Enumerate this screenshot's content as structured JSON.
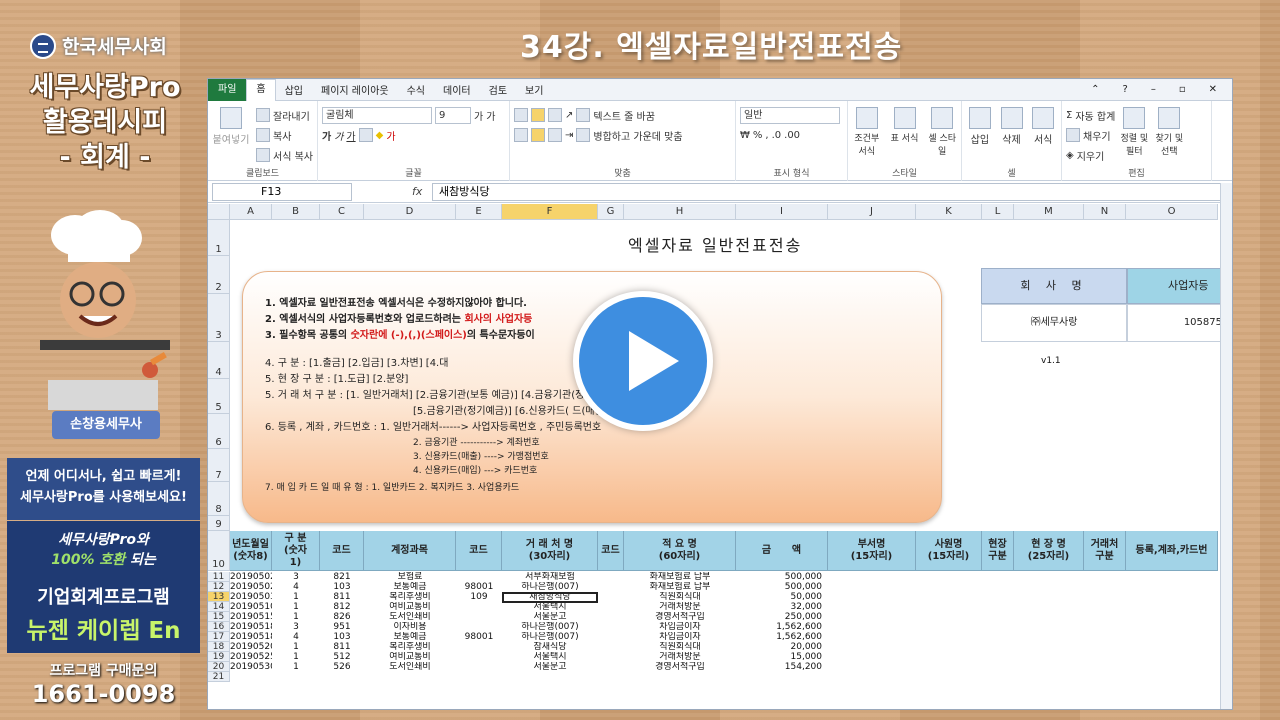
{
  "brand": {
    "name": "한국세무사회"
  },
  "left": {
    "title_lines": [
      "세무사랑Pro",
      "활용레시피",
      "- 회계 -"
    ],
    "presenter": "손창용세무사",
    "ad1": [
      "언제 어디서나, 쉽고 빠르게!",
      "세무사랑Pro를 사용해보세요!"
    ],
    "ad2_line1_a": "세무사랑Pro와",
    "ad2_line1_b": "100% 호환",
    "ad2_line1_c": " 되는",
    "ad2_line2": "기업회계프로그램",
    "ad2_line3": "뉴젠 케이렙 En",
    "contact_label": "프로그램 구매문의",
    "contact_number": "1661-0098"
  },
  "lecture_title": "34강. 엑셀자료일반전표전송",
  "excel": {
    "tabs": [
      "파일",
      "홈",
      "삽입",
      "페이지 레이아웃",
      "수식",
      "데이터",
      "검토",
      "보기"
    ],
    "clipboard": {
      "paste": "붙여넣기",
      "cut": "잘라내기",
      "copy": "복사",
      "format": "서식 복사",
      "label": "클립보드"
    },
    "font": {
      "name": "굴림체",
      "size": "9",
      "label": "글꼴"
    },
    "align": {
      "wrap": "텍스트 줄 바꿈",
      "merge": "병합하고 가운데 맞춤",
      "label": "맞춤"
    },
    "number": {
      "format": "일반",
      "label": "표시 형식"
    },
    "style": {
      "cond": "조건부 서식",
      "table": "표 서식",
      "cell": "셀 스타일",
      "label": "스타일"
    },
    "cells": {
      "insert": "삽입",
      "delete": "삭제",
      "format": "서식",
      "label": "셀"
    },
    "edit": {
      "sum": "자동 합계",
      "fill": "채우기",
      "clear": "지우기",
      "sort": "정렬 및 필터",
      "find": "찾기 및 선택",
      "label": "편집"
    },
    "name_box": "F13",
    "formula": "새참방식당",
    "columns": [
      "A",
      "B",
      "C",
      "D",
      "E",
      "F",
      "G",
      "H",
      "I",
      "J",
      "K",
      "L",
      "M",
      "N",
      "O"
    ],
    "sheet_title": "엑셀자료 일반전표전송",
    "company_header": "회 사 명",
    "bizno_header": "사업자등",
    "company_value": "㈜세무사랑",
    "bizno_value": "105875",
    "version": "v1.1",
    "notes": {
      "n1": "1. 엑셀자료 일반전표전송 엑셀서식은 수정하지않아야 합니다.",
      "n2a": "2. 엑셀서식의 사업자등록번호와 업로드하려는 ",
      "n2b": "회사의 사업자등",
      "n3a": "3. 필수항목 공통의 ",
      "n3b": "숫자란에 (-),(,)(스페이스)",
      "n3c": "의 특수문자등이",
      "n4": "4. 구                   분  :  [1.출금] [2.입금] [3.차변] [4.대",
      "n5": "5. 현      장      구      분  :  [1.도급] [2.분양]",
      "n6a": "5. 거   래   처     구   분  :  [1. 일반거래처] [2.금융기관(보통                    예금)] [4.금융기관(정기적금)]",
      "n6b": "[5.금융기관(정기예금)] [6.신용카드(                       드(매입)]",
      "n7": "6. 등록 , 계좌 , 카드번호  :  1. 일반거래처------>   사업자등록번호 , 주민등록번호",
      "n8": "2. 금융기관 ----------->  계좌번호",
      "n9": "3. 신용카드(매출) ---->  가맹점번호",
      "n10": "4. 신용카드(매입)  --->  카드번호",
      "n11": "7. 매 입 카 드  일 때     유  형  :  1. 일반카드     2. 복지카드     3. 사업용카드"
    },
    "table_headers": [
      "년도월일\n(숫자8)",
      "구 분\n(숫자\n1)",
      "코드",
      "계정과목",
      "코드",
      "거 래 처 명\n(30자리)",
      "코드",
      "적 요 명\n(60자리)",
      "금      액",
      "부서명\n(15자리)",
      "사원명\n(15자리)",
      "현장\n구분",
      "현 장 명\n(25자리)",
      "거래처\n구분",
      "등록,계좌,카드번"
    ],
    "rows": [
      [
        "11",
        "20190502",
        "3",
        "821",
        "보험료",
        "",
        "서부화재보험",
        "화재보험료 납부",
        "500,000"
      ],
      [
        "12",
        "20190502",
        "4",
        "103",
        "보통예금",
        "98001",
        "하나은행(007)",
        "화재보험료 납부",
        "500,000"
      ],
      [
        "13",
        "20190503",
        "1",
        "811",
        "복리후생비",
        "109",
        "새참방식당",
        "직원회식대",
        "50,000"
      ],
      [
        "14",
        "20190510",
        "1",
        "812",
        "여비교통비",
        "",
        "서울택시",
        "거래처방문",
        "32,000"
      ],
      [
        "15",
        "20190515",
        "1",
        "826",
        "도서인쇄비",
        "",
        "서울문고",
        "경영서적구입",
        "250,000"
      ],
      [
        "16",
        "20190518",
        "3",
        "951",
        "이자비용",
        "",
        "하나은행(007)",
        "차입금이자",
        "1,562,600"
      ],
      [
        "17",
        "20190518",
        "4",
        "103",
        "보통예금",
        "98001",
        "하나은행(007)",
        "차입금이자",
        "1,562,600"
      ],
      [
        "18",
        "20190520",
        "1",
        "811",
        "복리후생비",
        "",
        "참새식당",
        "직원회식대",
        "20,000"
      ],
      [
        "19",
        "20190525",
        "1",
        "512",
        "여비교통비",
        "",
        "서울택시",
        "거래처방문",
        "15,000"
      ],
      [
        "20",
        "20190530",
        "1",
        "526",
        "도서인쇄비",
        "",
        "서울문고",
        "경영서적구입",
        "154,200"
      ],
      [
        "21",
        "",
        "",
        "",
        "",
        "",
        "",
        "",
        ""
      ]
    ]
  },
  "colors": {
    "file_tab": "#1f7a3e",
    "header_fill": "#a2d3e7",
    "play": "#3e8ee0"
  }
}
